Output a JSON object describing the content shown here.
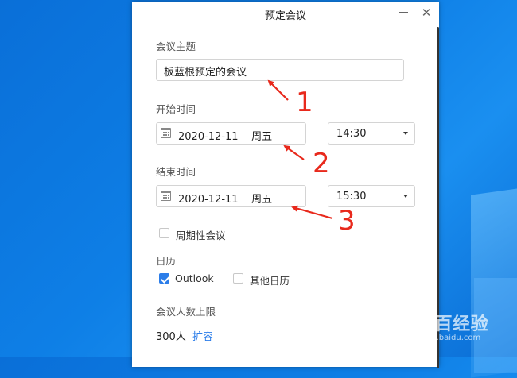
{
  "dialog": {
    "title": "预定会议",
    "minimize_icon": "minimize-icon",
    "close_icon": "close-icon"
  },
  "subject": {
    "label": "会议主题",
    "value": "板蓝根预定的会议"
  },
  "start": {
    "label": "开始时间",
    "date": "2020-12-11    周五",
    "time": "14:30"
  },
  "end": {
    "label": "结束时间",
    "date": "2020-12-11    周五",
    "time": "15:30"
  },
  "recurring": {
    "label": "周期性会议",
    "checked": false
  },
  "calendar": {
    "label": "日历",
    "options": [
      {
        "label": "Outlook",
        "checked": true
      },
      {
        "label": "其他日历",
        "checked": false
      }
    ]
  },
  "capacity": {
    "label": "会议人数上限",
    "value": "300人",
    "expand_link": "扩容"
  },
  "annotations": {
    "arrow_color": "#e8291c",
    "n1": "1",
    "n2": "2",
    "n3": "3"
  },
  "watermark": {
    "main": "Bai百经验",
    "sub": "jingyan.baidu.com"
  },
  "colors": {
    "accent": "#2b7de9",
    "desktop": "#0e7fe6"
  }
}
